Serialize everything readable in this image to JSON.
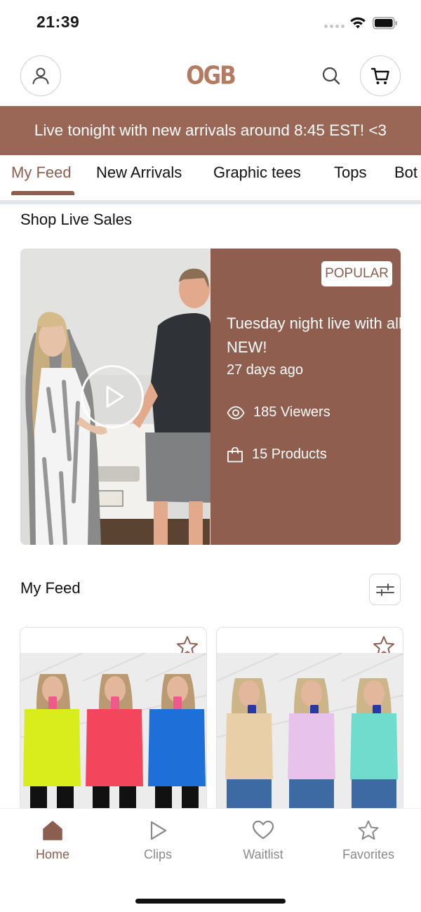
{
  "status_bar": {
    "time": "21:39"
  },
  "header": {
    "logo_text": "OGB",
    "icons": [
      "profile-icon",
      "search-icon",
      "cart-icon"
    ]
  },
  "banner": {
    "text": "Live tonight with new arrivals around 8:45 EST! <3"
  },
  "tabs": [
    {
      "label": "My Feed",
      "active": true
    },
    {
      "label": "New Arrivals",
      "active": false
    },
    {
      "label": "Graphic tees",
      "active": false
    },
    {
      "label": "Tops",
      "active": false
    },
    {
      "label": "Bot",
      "active": false
    }
  ],
  "live_section": {
    "title": "Shop Live Sales",
    "card": {
      "badge": "POPULAR",
      "title": "Tuesday night live with all NEW!",
      "age": "27 days ago",
      "viewers": "185 Viewers",
      "products": "15 Products"
    }
  },
  "feed_section": {
    "title": "My Feed",
    "products": [
      {
        "favorited": false,
        "colors": [
          "#d9ec1c",
          "#f3465d",
          "#1f6fd8"
        ]
      },
      {
        "favorited": false,
        "colors": [
          "#e8cfa8",
          "#e7c3ec",
          "#6fdccd"
        ]
      }
    ]
  },
  "bottom_nav": [
    {
      "label": "Home",
      "icon": "home-icon",
      "active": true
    },
    {
      "label": "Clips",
      "icon": "play-icon",
      "active": false
    },
    {
      "label": "Waitlist",
      "icon": "heart-icon",
      "active": false
    },
    {
      "label": "Favorites",
      "icon": "star-icon",
      "active": false
    }
  ],
  "colors": {
    "brand": "#9a6656",
    "brand_dark": "#8c5e50",
    "card_bg": "#8f5e4f"
  }
}
